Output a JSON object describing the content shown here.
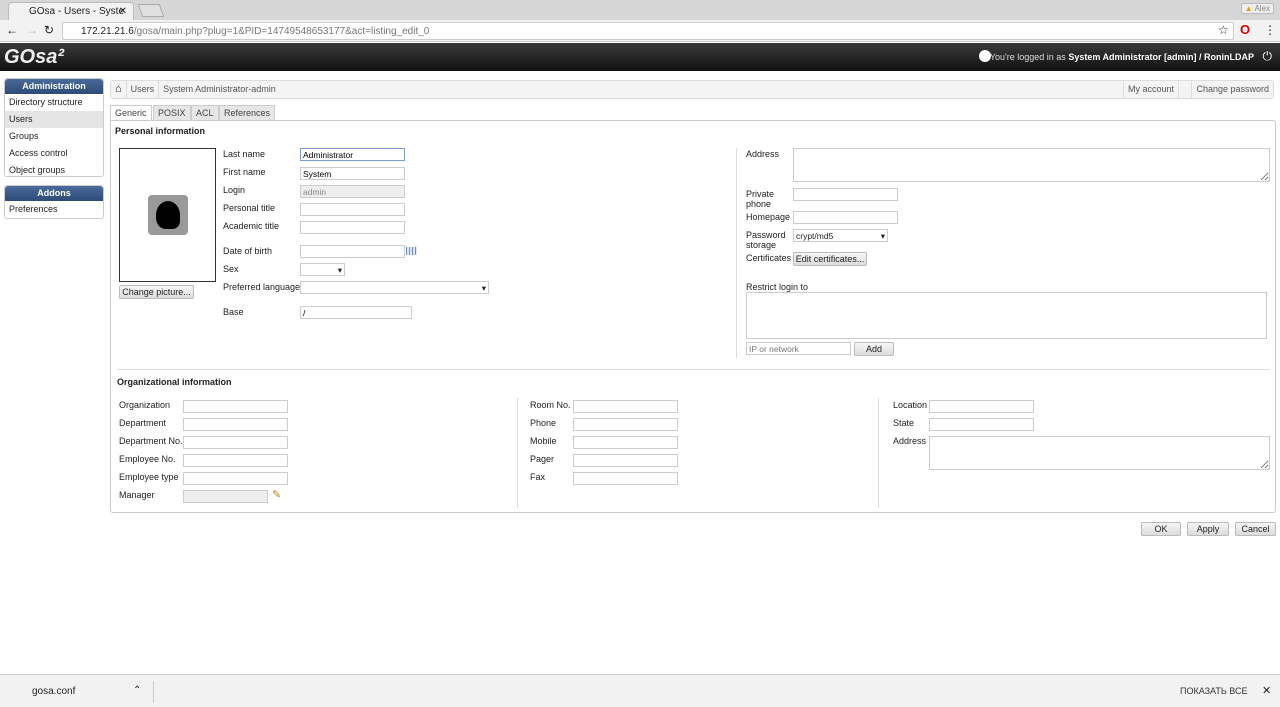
{
  "browser": {
    "tab_title": "GOsa - Users - Syste",
    "url_host": "172.21.21.6",
    "url_path": "/gosa/main.php?plug=1&PID=14749548653177&act=listing_edit_0",
    "profile": "Alex"
  },
  "header": {
    "logo": "GOsa²",
    "logged_prefix": "You're logged in as ",
    "logged_user": "System Administrator [admin] / RoninLDAP"
  },
  "sidebar": {
    "admin_title": "Administration",
    "admin_items": [
      "Directory structure",
      "Users",
      "Groups",
      "Access control",
      "Object groups"
    ],
    "addons_title": "Addons",
    "addons_items": [
      "Preferences"
    ]
  },
  "breadcrumb": {
    "items": [
      "Users",
      "System Administrator-admin"
    ],
    "my_account": "My account",
    "change_password": "Change password"
  },
  "tabs": [
    "Generic",
    "POSIX",
    "ACL",
    "References"
  ],
  "personal": {
    "title": "Personal information",
    "change_picture": "Change picture...",
    "last_name_label": "Last name",
    "last_name": "Administrator",
    "first_name_label": "First name",
    "first_name": "System",
    "login_label": "Login",
    "login": "admin",
    "personal_title_label": "Personal title",
    "academic_title_label": "Academic title",
    "dob_label": "Date of birth",
    "sex_label": "Sex",
    "lang_label": "Preferred language",
    "base_label": "Base",
    "base": "/",
    "address_label": "Address",
    "private_phone_label": "Private phone",
    "homepage_label": "Homepage",
    "pw_storage_label": "Password storage",
    "pw_storage": "crypt/md5",
    "certificates_label": "Certificates",
    "edit_certificates": "Edit certificates...",
    "restrict_label": "Restrict login to",
    "ip_placeholder": "IP or network",
    "add": "Add"
  },
  "org": {
    "title": "Organizational information",
    "col1": [
      "Organization",
      "Department",
      "Department No.",
      "Employee No.",
      "Employee type",
      "Manager"
    ],
    "col2": [
      "Room No.",
      "Phone",
      "Mobile",
      "Pager",
      "Fax"
    ],
    "col3": [
      "Location",
      "State"
    ],
    "address_label": "Address"
  },
  "actions": {
    "ok": "OK",
    "apply": "Apply",
    "cancel": "Cancel"
  },
  "downloads": {
    "file": "gosa.conf",
    "show_all": "ПОКАЗАТЬ ВСЕ"
  }
}
